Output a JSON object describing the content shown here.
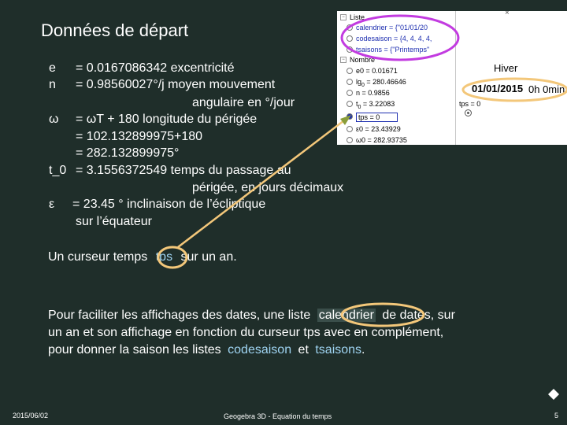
{
  "slide": {
    "title": "Données de départ",
    "rows": [
      {
        "sym": "e",
        "text": "= 0.0167086342   excentricité"
      },
      {
        "sym": "n",
        "text": "=  0.98560027°/j   moyen mouvement"
      },
      {
        "sym": "",
        "text": "angulaire en °/jour"
      },
      {
        "sym": "ω",
        "text": " = ωT + 180           longitude du périgée"
      },
      {
        "sym": "",
        "text": "= 102.132899975+180"
      },
      {
        "sym": "",
        "text": "= 282.132899975°"
      },
      {
        "sym": "t_0",
        "text": "= 3.1556372549   temps du passage au"
      },
      {
        "sym": "",
        "text": "périgée, en jours décimaux"
      },
      {
        "sym": "ε",
        "text": " = 23.45 ° inclinaison de l’écliptique"
      },
      {
        "sym": "",
        "text": "sur l’équateur"
      }
    ],
    "cursor_text_before": "Un curseur temps",
    "cursor_word": "tps",
    "cursor_text_after": "sur un an.",
    "para_line1_before": "Pour faciliter les affichages des dates, une liste",
    "para_word": "calendrier",
    "para_line1_after": "de dates, sur",
    "para_line2": "un an et son affichage en fonction du curseur tps avec en complément,",
    "para_line3_before": "pour donner la saison les listes",
    "para_word2": "codesaison",
    "para_and": "et",
    "para_word3": "tsaisons",
    "para_end": "."
  },
  "geogebra": {
    "algebra": {
      "liste_header": "Liste",
      "calendrier": "calendrier = {\"01/01/20",
      "codesaison": "codesaison = {4, 4, 4, 4,",
      "tsaisons": "tsaisons = {\"Printemps\"",
      "nombre_header": "Nombre",
      "e0": "e0 = 0.01671",
      "lg0_pre": "lg",
      "lg0_sub": "0",
      "lg0_post": " = 280.46646",
      "n": "n = 0.9856",
      "t0_pre": "t",
      "t0_sub": "0",
      "t0_post": " = 3.22083",
      "tps": "tps = 0",
      "e0b": "ε0 = 23.43929",
      "w0": "ω0 = 282.93735"
    },
    "graphics": {
      "season": "Hiver",
      "date": "01/01/2015",
      "time": "0h 0min",
      "slider_label": "tps = 0"
    }
  },
  "footer": {
    "date": "2015/06/02",
    "center": "Geogebra  3D - Equation du temps",
    "page": "5"
  },
  "colors": {
    "background": "#1f2e2a",
    "highlight_circle": "#f3c77a",
    "arrow": "#f3c77a",
    "list_circle": "#c23be0",
    "code_blue": "#9fd4f2"
  }
}
